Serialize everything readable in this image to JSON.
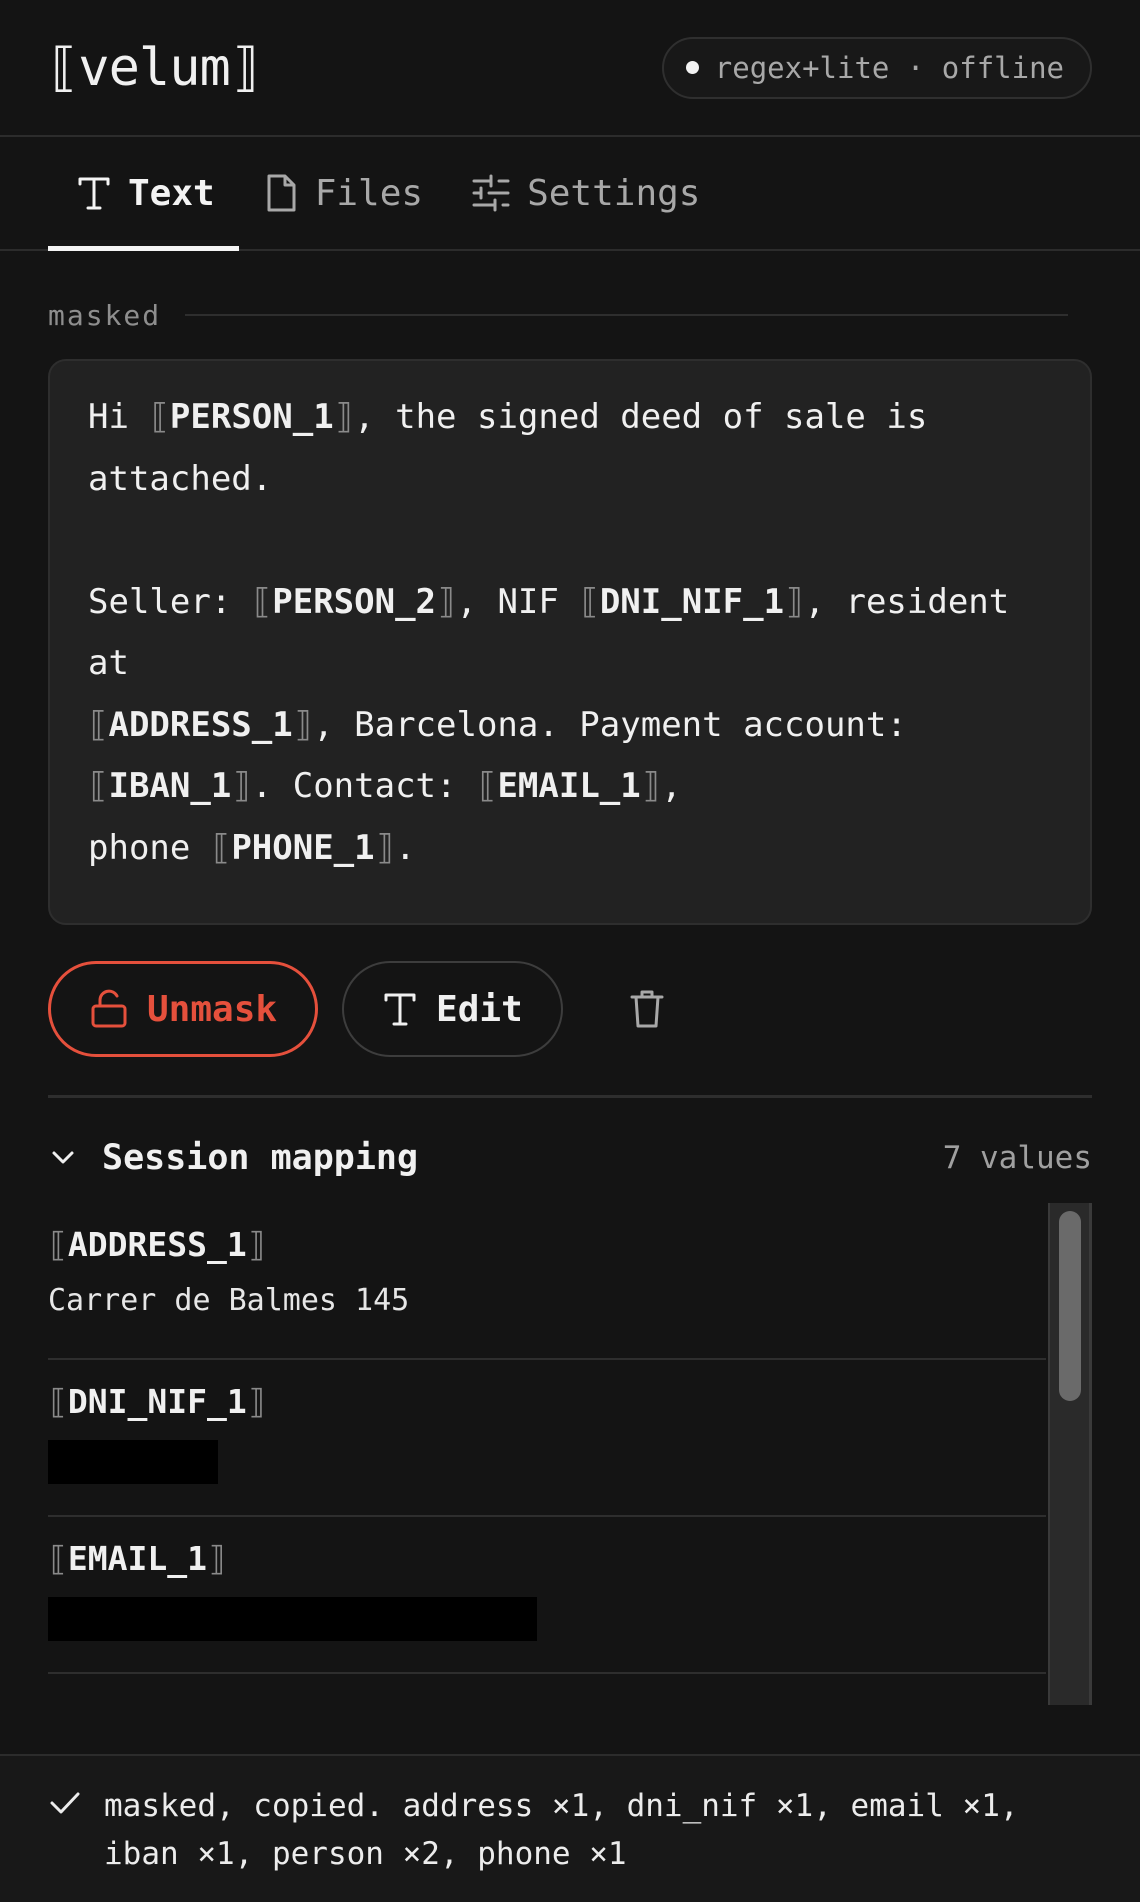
{
  "header": {
    "logo": "⟦velum⟧",
    "status": "regex+lite · offline"
  },
  "tabs": [
    {
      "label": "Text",
      "icon": "text-icon",
      "active": true
    },
    {
      "label": "Files",
      "icon": "file-icon",
      "active": false
    },
    {
      "label": "Settings",
      "icon": "sliders-icon",
      "active": false
    }
  ],
  "masked": {
    "label": "masked",
    "lines": [
      {
        "t": "Hi ",
        "tok": "PERSON_1",
        "after": ", the signed deed of sale is"
      },
      {
        "t": "attached."
      }
    ],
    "text_parts": [
      "Hi ",
      "⟦",
      "PERSON_1",
      "⟧",
      ", the signed deed of sale is\nattached.\n\nSeller: ",
      "⟦",
      "PERSON_2",
      "⟧",
      ", NIF ",
      "⟦",
      "DNI_NIF_1",
      "⟧",
      ", resident\nat\n",
      "⟦",
      "ADDRESS_1",
      "⟧",
      ", Barcelona. Payment account:\n",
      "⟦",
      "IBAN_1",
      "⟧",
      ". Contact: ",
      "⟦",
      "EMAIL_1",
      "⟧",
      ",\nphone ",
      "⟦",
      "PHONE_1",
      "⟧",
      "."
    ]
  },
  "actions": {
    "unmask_label": "Unmask",
    "edit_label": "Edit",
    "delete_icon": "trash-icon"
  },
  "mapping": {
    "title": "Session mapping",
    "count": "7 values",
    "items": [
      {
        "key": "ADDRESS_1",
        "value": "Carrer de Balmes 145",
        "redacted": false
      },
      {
        "key": "DNI_NIF_1",
        "value": "",
        "redacted": true,
        "redact_fraction": 0.17
      },
      {
        "key": "EMAIL_1",
        "value": "",
        "redacted": true,
        "redact_fraction": 0.49
      }
    ],
    "bracket_open": "⟦",
    "bracket_close": "⟧"
  },
  "footer": {
    "message": "masked, copied. address ×1, dni_nif ×1, email ×1, iban ×1, person ×2, phone ×1"
  },
  "colors": {
    "accent": "#e5503c",
    "background": "#141414",
    "panel": "#222222"
  }
}
